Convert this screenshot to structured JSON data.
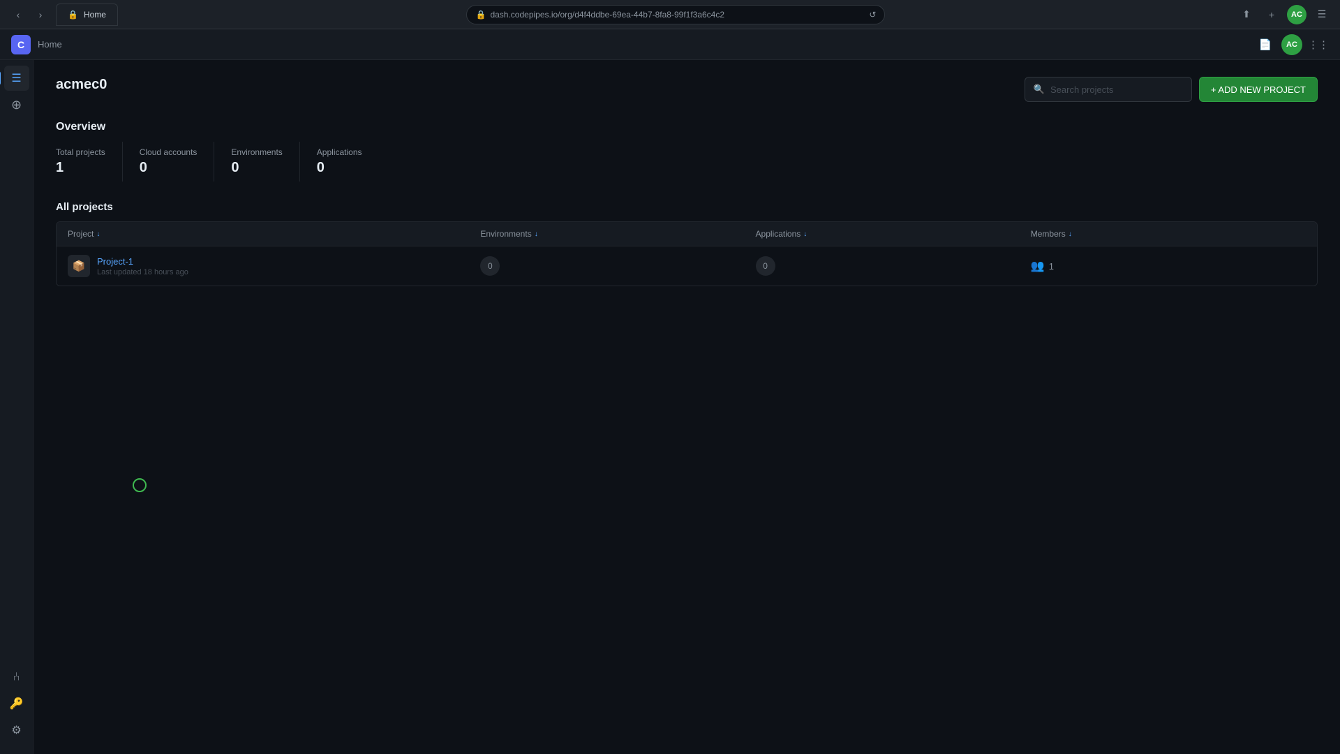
{
  "browser": {
    "tab_label": "Home",
    "address": "dash.codepipes.io/org/d4f4ddbe-69ea-44b7-8fa8-99f1f3a6c4c2",
    "favicon": "🔒",
    "reload_icon": "↺"
  },
  "nav": {
    "logo_text": "C",
    "home_label": "Home",
    "avatar_initials": "AC"
  },
  "sidebar": {
    "items": [
      {
        "name": "menu-icon",
        "icon": "☰",
        "active": true
      },
      {
        "name": "home-icon",
        "icon": "⊕",
        "active": false
      },
      {
        "name": "branch-icon",
        "icon": "⑃",
        "active": false
      },
      {
        "name": "settings-icon",
        "icon": "⚙",
        "active": false
      }
    ]
  },
  "page": {
    "org_name": "acmec0",
    "search_placeholder": "Search projects",
    "add_button_label": "+ ADD NEW PROJECT",
    "overview_title": "Overview",
    "all_projects_title": "All projects",
    "stats": [
      {
        "label": "Total projects",
        "value": "1"
      },
      {
        "label": "Cloud accounts",
        "value": "0"
      },
      {
        "label": "Environments",
        "value": "0"
      },
      {
        "label": "Applications",
        "value": "0"
      }
    ],
    "table": {
      "columns": [
        {
          "label": "Project",
          "sort": true
        },
        {
          "label": "Environments",
          "sort": true
        },
        {
          "label": "Applications",
          "sort": true
        },
        {
          "label": "Members",
          "sort": true
        }
      ],
      "rows": [
        {
          "name": "Project-1",
          "updated": "Last updated 18 hours ago",
          "environments": "0",
          "applications": "0",
          "members": "1"
        }
      ]
    }
  }
}
